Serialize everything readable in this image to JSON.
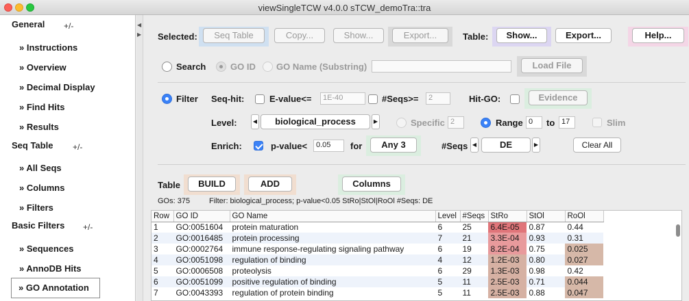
{
  "window": {
    "title": "viewSingleTCW v4.0.0   sTCW_demoTra::tra"
  },
  "sidebar": {
    "sections": [
      {
        "label": "General",
        "toggle": "+/-"
      },
      {
        "label": "Seq Table",
        "toggle": "+/-"
      },
      {
        "label": "Basic Filters",
        "toggle": "+/-"
      }
    ],
    "items": [
      "» Instructions",
      "» Overview",
      "» Decimal Display",
      "» Find Hits",
      "» Results",
      "» All Seqs",
      "» Columns",
      "» Filters",
      "» Sequences",
      "» AnnoDB Hits",
      "» GO Annotation"
    ],
    "selected_index": 10
  },
  "toolbar": {
    "selected_label": "Selected:",
    "seq_table": "Seq Table",
    "copy": "Copy...",
    "show_sel": "Show...",
    "export_sel": "Export...",
    "table_label": "Table:",
    "show_table": "Show...",
    "export_table": "Export...",
    "help": "Help..."
  },
  "search": {
    "label": "Search",
    "go_id": "GO ID",
    "go_name": "GO Name (Substring)",
    "value": "",
    "load_file": "Load File"
  },
  "filter": {
    "label": "Filter",
    "seq_hit_label": "Seq-hit:",
    "evalue_label": "E-value<=",
    "evalue_value": "1E-40",
    "nseqs_label": "#Seqs>=",
    "nseqs_value": "2",
    "hit_go_label": "Hit-GO:",
    "evidence": "Evidence",
    "level_label": "Level:",
    "level_value": "biological_process",
    "specific_label": "Specific",
    "specific_value": "2",
    "range_label": "Range",
    "range_from": "0",
    "range_to_label": "to",
    "range_to": "17",
    "slim_label": "Slim",
    "enrich_label": "Enrich:",
    "pvalue_label": "p-value<",
    "pvalue_value": "0.05",
    "for_label": "for",
    "any_value": "Any 3",
    "nseqs2_label": "#Seqs",
    "de_value": "DE",
    "clear_all": "Clear All"
  },
  "table_controls": {
    "label": "Table",
    "build": "BUILD",
    "add": "ADD",
    "columns": "Columns"
  },
  "status": {
    "gos": "GOs: 375",
    "filter_text": "Filter: biological_process; p-value<0.05 StRo|StOl|RoOl   #Seqs: DE"
  },
  "results_table": {
    "headers": [
      "Row",
      "GO ID",
      "GO Name",
      "Level",
      "#Seqs",
      "StRo",
      "StOl",
      "RoOl"
    ],
    "rows": [
      [
        "1",
        "GO:0051604",
        "protein maturation",
        "6",
        "25",
        "6.4E-05",
        "0.87",
        "0.44"
      ],
      [
        "2",
        "GO:0016485",
        "protein processing",
        "7",
        "21",
        "3.3E-04",
        "0.93",
        "0.31"
      ],
      [
        "3",
        "GO:0002764",
        "immune response-regulating signaling pathway",
        "6",
        "19",
        "8.2E-04",
        "0.75",
        "0.025"
      ],
      [
        "4",
        "GO:0051098",
        "regulation of binding",
        "4",
        "12",
        "1.2E-03",
        "0.80",
        "0.027"
      ],
      [
        "5",
        "GO:0006508",
        "proteolysis",
        "6",
        "29",
        "1.3E-03",
        "0.98",
        "0.42"
      ],
      [
        "6",
        "GO:0051099",
        "positive regulation of binding",
        "5",
        "11",
        "2.5E-03",
        "0.71",
        "0.044"
      ],
      [
        "7",
        "GO:0043393",
        "regulation of protein binding",
        "5",
        "11",
        "2.5E-03",
        "0.88",
        "0.047"
      ]
    ],
    "highlight": {
      "StRo": [
        "#e0757a",
        "#e89a9c",
        "#e89a9c",
        "#d6b1a3",
        "#d6b1a3",
        "#d6b1a3",
        "#d6b1a3"
      ],
      "RoOl": [
        "",
        "",
        "#d6b8a8",
        "#d6b8a8",
        "",
        "#d6b8a8",
        "#d6b8a8"
      ]
    }
  },
  "colors": {
    "accent": "#3b82f7",
    "halo_blue": "#cfe0f1",
    "halo_gray": "#d9d9d9",
    "halo_purple": "#dcd6f2",
    "halo_pink": "#f4d6e6",
    "halo_green": "#dbeee0",
    "halo_peach": "#f1ded0"
  }
}
